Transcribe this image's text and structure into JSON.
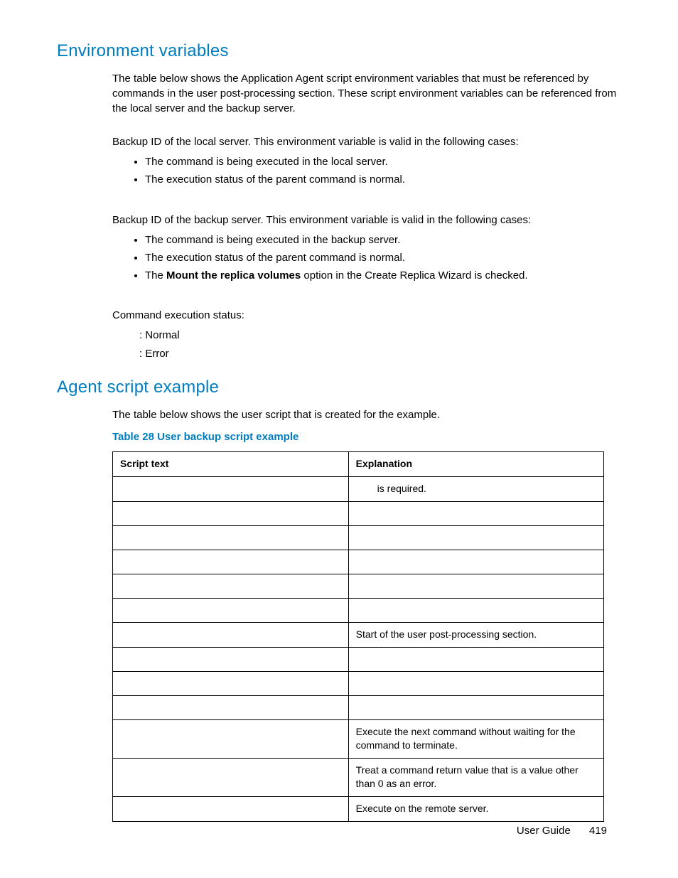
{
  "sections": {
    "env": {
      "heading": "Environment variables",
      "intro": "The table below shows the Application Agent script environment variables that must be referenced by commands in the user post-processing section. These script environment variables can be referenced from the local server and the backup server.",
      "local_line": "Backup ID of the local server. This environment variable is valid in the following cases:",
      "local_bullets": [
        "The command is being executed in the local server.",
        "The execution status of the parent command is normal."
      ],
      "backup_line": "Backup ID of the backup server. This environment variable is valid in the following cases:",
      "backup_bullets_pre": [
        "The command is being executed in the backup server.",
        "The execution status of the parent command is normal."
      ],
      "backup_bullet_mount_pre": "The ",
      "backup_bullet_mount_bold": "Mount the replica volumes",
      "backup_bullet_mount_post": " option in the Create Replica Wizard is checked.",
      "status_line": "Command execution status:",
      "status_items": [
        ": Normal",
        ": Error"
      ]
    },
    "agent": {
      "heading": "Agent script example",
      "intro": "The table below shows the user script that is created for the example.",
      "table_title": "Table 28 User backup script example",
      "headers": {
        "c1": "Script text",
        "c2": "Explanation"
      },
      "rows": [
        {
          "script": "",
          "expl": " is required.",
          "expl_pad": true
        },
        {
          "script": "",
          "expl": ""
        },
        {
          "script": "",
          "expl": ""
        },
        {
          "script": "",
          "expl": ""
        },
        {
          "script": "",
          "expl": ""
        },
        {
          "script": "",
          "expl": ""
        },
        {
          "script": "",
          "expl": "Start of the user post-processing section."
        },
        {
          "script": "",
          "expl": ""
        },
        {
          "script": "",
          "expl": ""
        },
        {
          "script": "",
          "expl": ""
        },
        {
          "script": "",
          "expl": "Execute the next command without waiting for the command to terminate."
        },
        {
          "script": "",
          "expl": "Treat a command return value that is a value other than 0 as an error."
        },
        {
          "script": "",
          "expl": "Execute on the remote server."
        }
      ]
    }
  },
  "footer": {
    "label": "User Guide",
    "page": "419"
  }
}
